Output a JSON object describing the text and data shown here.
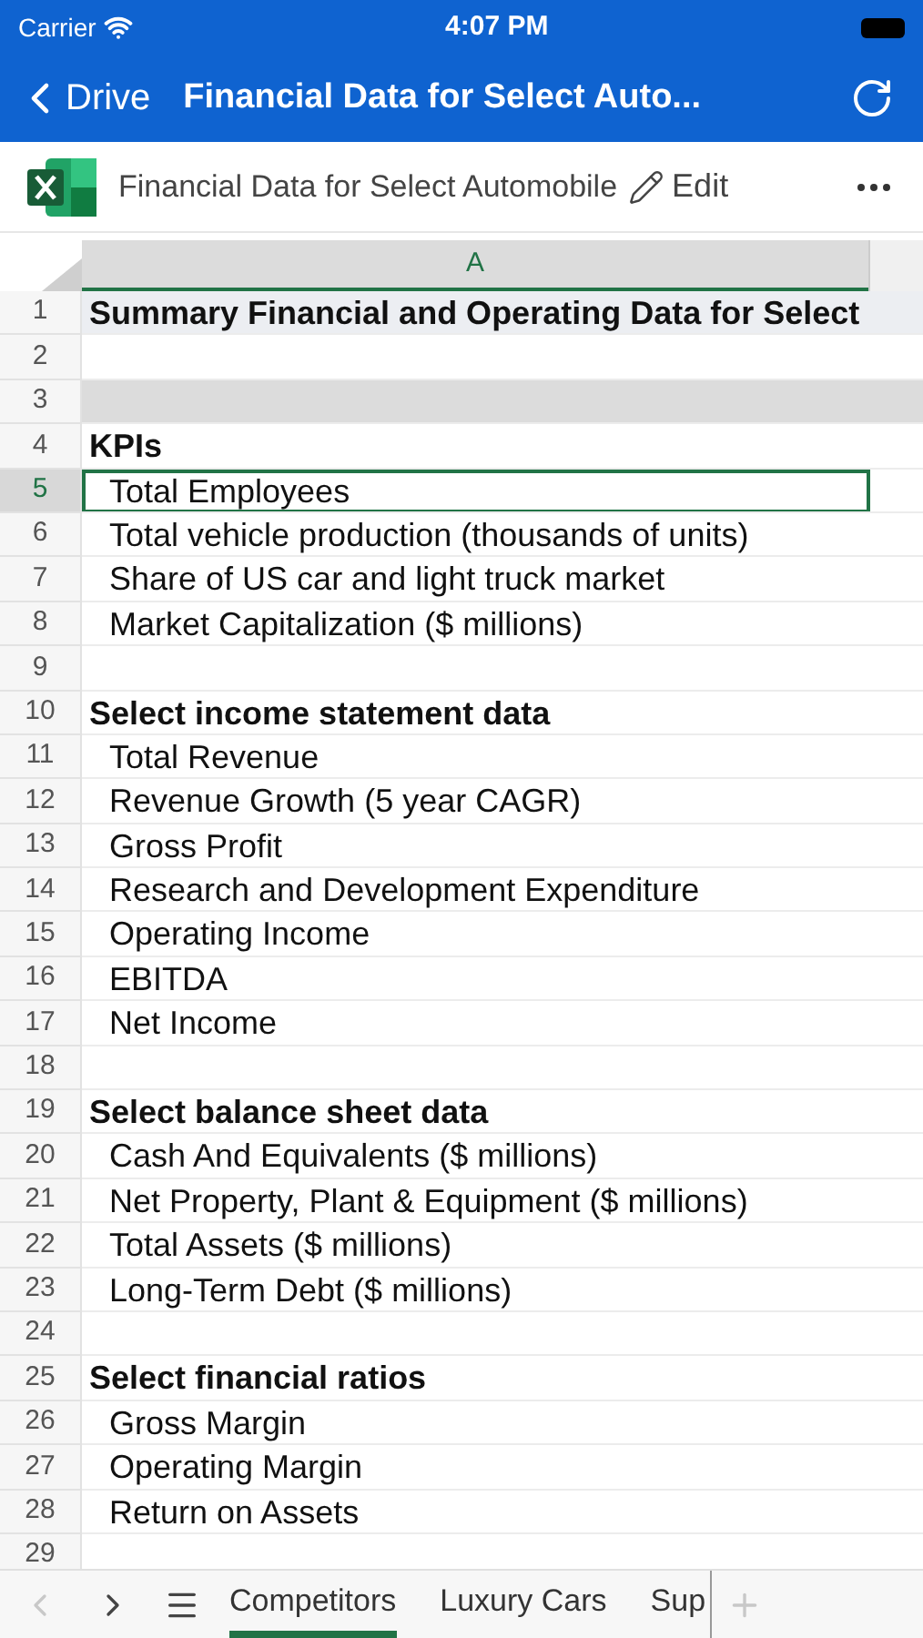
{
  "status_bar": {
    "carrier": "Carrier",
    "time": "4:07 PM"
  },
  "nav": {
    "back": "Drive",
    "title": "Financial Data for Select Auto..."
  },
  "toolbar": {
    "file_name": "Financial Data for Select Automobile",
    "edit": "Edit"
  },
  "sheet": {
    "column": {
      "label": "A",
      "selected": true
    },
    "rows": [
      {
        "number": "1",
        "kind": "title",
        "text": "Summary Financial and Operating Data for Select",
        "selected": false
      },
      {
        "number": "2",
        "kind": "blank",
        "selected": false
      },
      {
        "number": "3",
        "kind": "band",
        "selected": false
      },
      {
        "number": "4",
        "kind": "header",
        "text": "KPIs",
        "selected": false
      },
      {
        "number": "5",
        "kind": "item",
        "text": "Total Employees",
        "selected": true
      },
      {
        "number": "6",
        "kind": "item",
        "text": "Total vehicle production (thousands of units)",
        "selected": false
      },
      {
        "number": "7",
        "kind": "item",
        "text": "Share of US car and light truck market",
        "selected": false
      },
      {
        "number": "8",
        "kind": "item",
        "text": "Market Capitalization ($ millions)",
        "selected": false
      },
      {
        "number": "9",
        "kind": "blank",
        "selected": false
      },
      {
        "number": "10",
        "kind": "header",
        "text": "Select income statement data",
        "selected": false
      },
      {
        "number": "11",
        "kind": "item",
        "text": "Total Revenue",
        "selected": false
      },
      {
        "number": "12",
        "kind": "item",
        "text": "Revenue Growth (5 year CAGR)",
        "selected": false
      },
      {
        "number": "13",
        "kind": "item",
        "text": "Gross Profit",
        "selected": false
      },
      {
        "number": "14",
        "kind": "item",
        "text": "Research and Development Expenditure",
        "selected": false
      },
      {
        "number": "15",
        "kind": "item",
        "text": "Operating Income",
        "selected": false
      },
      {
        "number": "16",
        "kind": "item",
        "text": "EBITDA",
        "selected": false
      },
      {
        "number": "17",
        "kind": "item",
        "text": "Net Income",
        "selected": false
      },
      {
        "number": "18",
        "kind": "blank",
        "selected": false
      },
      {
        "number": "19",
        "kind": "header",
        "text": "Select balance sheet data",
        "selected": false
      },
      {
        "number": "20",
        "kind": "item",
        "text": "Cash And Equivalents ($ millions)",
        "selected": false
      },
      {
        "number": "21",
        "kind": "item",
        "text": "Net Property, Plant & Equipment ($ millions)",
        "selected": false
      },
      {
        "number": "22",
        "kind": "item",
        "text": "Total Assets ($ millions)",
        "selected": false
      },
      {
        "number": "23",
        "kind": "item",
        "text": "Long-Term Debt ($ millions)",
        "selected": false
      },
      {
        "number": "24",
        "kind": "blank",
        "selected": false
      },
      {
        "number": "25",
        "kind": "header",
        "text": "Select financial ratios",
        "selected": false
      },
      {
        "number": "26",
        "kind": "item",
        "text": "Gross Margin",
        "selected": false
      },
      {
        "number": "27",
        "kind": "item",
        "text": "Operating Margin",
        "selected": false
      },
      {
        "number": "28",
        "kind": "item",
        "text": "Return on Assets",
        "selected": false
      },
      {
        "number": "29",
        "kind": "blank",
        "selected": false
      }
    ]
  },
  "sheet_tabs": {
    "previous_disabled": true,
    "tabs": [
      {
        "label": "Competitors",
        "selected": true
      },
      {
        "label": "Luxury Cars",
        "selected": false
      },
      {
        "label": "Sup",
        "selected": false
      }
    ]
  }
}
